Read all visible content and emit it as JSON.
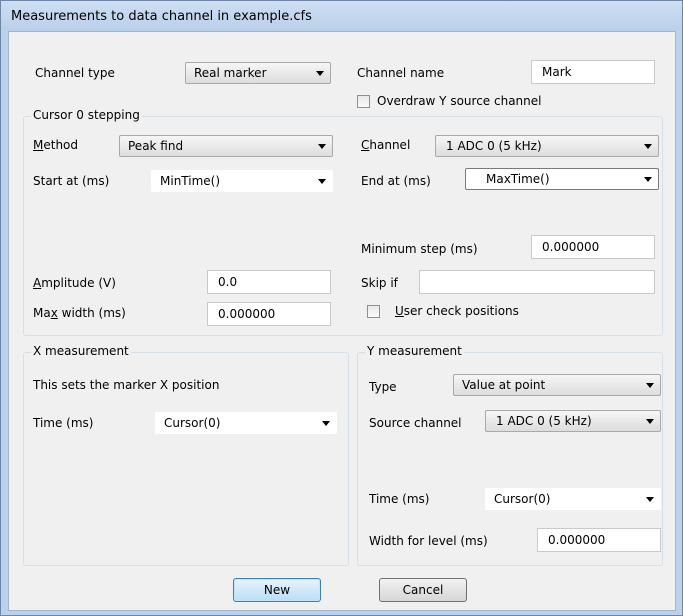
{
  "window": {
    "title": "Measurements to data channel in example.cfs"
  },
  "top": {
    "channel_type_label": "Channel type",
    "channel_type_value": "Real marker",
    "channel_name_label": "Channel name",
    "channel_name_value": "Mark",
    "overdraw_label": "Overdraw Y source channel",
    "overdraw_checked": false
  },
  "cursor_stepping": {
    "caption": "Cursor 0 stepping",
    "method_pre": "M",
    "method_post": "ethod",
    "method_value": "Peak find",
    "channel_pre": "C",
    "channel_post": "hannel",
    "channel_value": "1 ADC 0 (5 kHz)",
    "start_label": "Start at (ms)",
    "start_value": "MinTime()",
    "end_label": "End at (ms)",
    "end_value": "MaxTime()",
    "min_step_label": "Minimum step (ms)",
    "min_step_value": "0.000000",
    "amplitude_pre": "A",
    "amplitude_post": "mplitude (V)",
    "amplitude_value": "0.0",
    "skip_label": "Skip if",
    "skip_value": "",
    "max_width_pre": "Ma",
    "max_width_u": "x",
    "max_width_post": " width (ms)",
    "max_width_value": "0.000000",
    "user_check_u": "U",
    "user_check_post": "ser check positions",
    "user_check_checked": false
  },
  "x_measurement": {
    "caption": "X measurement",
    "info": "This sets the marker X position",
    "time_label": "Time (ms)",
    "time_value": "Cursor(0)"
  },
  "y_measurement": {
    "caption": "Y measurement",
    "type_label": "Type",
    "type_value": "Value at point",
    "source_label": "Source channel",
    "source_value": "1 ADC 0 (5 kHz)",
    "time_label": "Time (ms)",
    "time_value": "Cursor(0)",
    "width_label": "Width for level (ms)",
    "width_value": "0.000000"
  },
  "buttons": {
    "new": "New",
    "cancel": "Cancel"
  },
  "colors": {
    "window_frame": "#bcd1ea",
    "client_bg": "#f0f0f0",
    "default_button": "#b9def5"
  }
}
